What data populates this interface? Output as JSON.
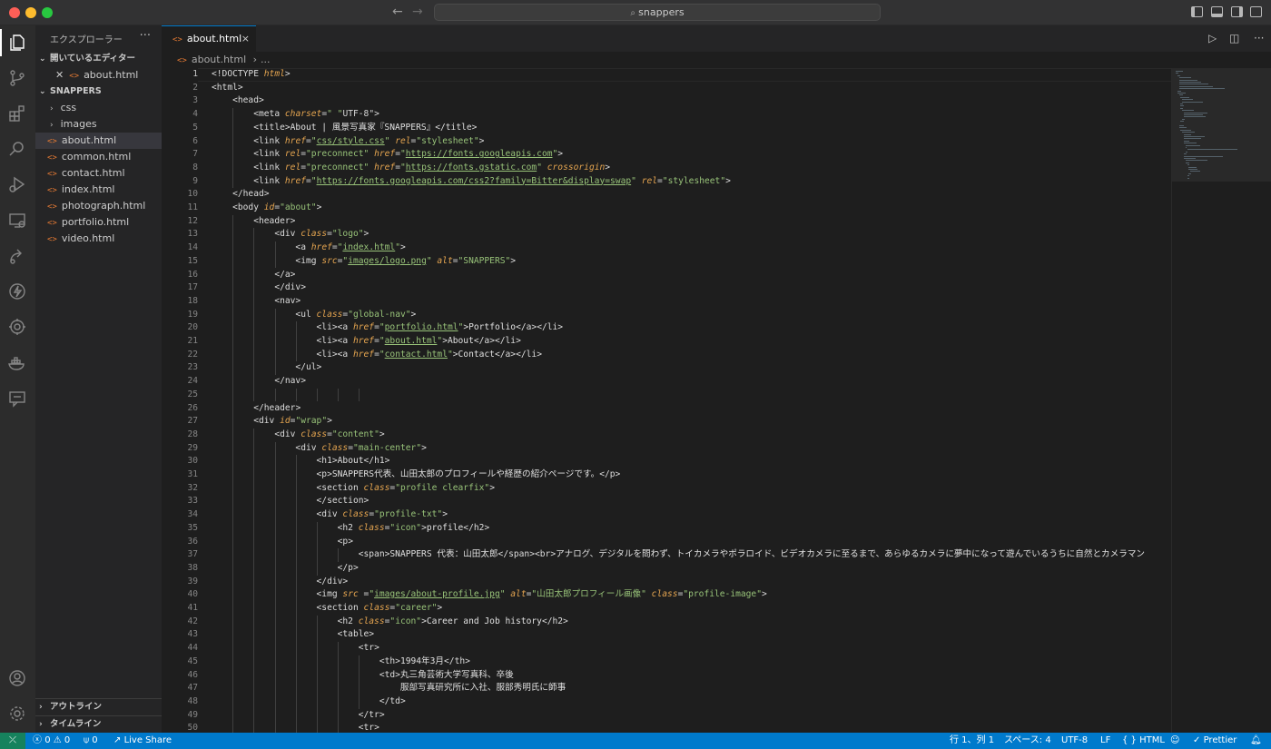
{
  "window": {
    "search_text": "snappers"
  },
  "sidebar": {
    "title": "エクスプローラー",
    "more": "···",
    "open_editors_label": "開いているエディター",
    "open_editor_file": "about.html",
    "project_label": "SNAPPERS",
    "folders": [
      "css",
      "images"
    ],
    "files": [
      "about.html",
      "common.html",
      "contact.html",
      "index.html",
      "photograph.html",
      "portfolio.html",
      "video.html"
    ],
    "outline_label": "アウトライン",
    "timeline_label": "タイムライン"
  },
  "tab": {
    "label": "about.html",
    "close": "×"
  },
  "breadcrumb": {
    "file": "about.html",
    "more": "..."
  },
  "editor": {
    "active_line": 1,
    "lines": [
      "<!DOCTYPE html>",
      "<html>",
      "    <head>",
      "        <meta charset=\" \"UTF-8\">",
      "        <title>About | 風景写真家『SNAPPERS』</title>",
      "        <link href=\"css/style.css\" rel=\"stylesheet\">",
      "        <link rel=\"preconnect\" href=\"https://fonts.googleapis.com\">",
      "        <link rel=\"preconnect\" href=\"https://fonts.gstatic.com\" crossorigin>",
      "        <link href=\"https://fonts.googleapis.com/css2?family=Bitter&display=swap\" rel=\"stylesheet\">",
      "    </head>",
      "    <body id=\"about\">",
      "        <header>",
      "            <div class=\"logo\">",
      "                <a href=\"index.html\">",
      "                <img src=\"images/logo.png\" alt=\"SNAPPERS\">",
      "            </a>",
      "            </div>",
      "            <nav>",
      "                <ul class=\"global-nav\">",
      "                    <li><a href=\"portfolio.html\">Portfolio</a></li>",
      "                    <li><a href=\"about.html\">About</a></li>",
      "                    <li><a href=\"contact.html\">Contact</a></li>",
      "                </ul>",
      "            </nav>",
      "",
      "        </header>",
      "        <div id=\"wrap\">",
      "            <div class=\"content\">",
      "                <div class=\"main-center\">",
      "                    <h1>About</h1>",
      "                    <p>SNAPPERS代表、山田太郎のプロフィールや経歴の紹介ページです。</p>",
      "                    <section class=\"profile clearfix\">",
      "                    </section>",
      "                    <div class=\"profile-txt\">",
      "                        <h2 class=\"icon\">profile</h2>",
      "                        <p>",
      "                            <span>SNAPPERS 代表：山田太郎</span><br>アナログ、デジタルを問わず、トイカメラやポラロイド、ビデオカメラに至るまで、あらゆるカメラに夢中になって遊んでいるうちに自然とカメラマン",
      "                        </p>",
      "                    </div>",
      "                    <img src =\"images/about-profile.jpg\" alt=\"山田太郎プロフィール画像\" class=\"profile-image\">",
      "                    <section class=\"career\">",
      "                        <h2 class=\"icon\">Career and Job history</h2>",
      "                        <table>",
      "                            <tr>",
      "                                <th>1994年3月</th>",
      "                                <td>丸三角芸術大学写真科、卒後",
      "                                    服部写真研究所に入社、服部秀明氏に師事",
      "                                </td>",
      "                            </tr>",
      "                            <tr>"
    ]
  },
  "statusbar": {
    "errors": "0",
    "warnings": "0",
    "ports": "0",
    "live_share": "Live Share",
    "position": "行 1、列 1",
    "spaces": "スペース: 4",
    "encoding": "UTF-8",
    "eol": "LF",
    "language": "HTML",
    "prettier": "Prettier"
  },
  "colors": {
    "accent": "#007acc",
    "tag": "#dcdcdc",
    "attribute": "#e5a550",
    "string": "#98c379",
    "background": "#1e1e1e"
  }
}
